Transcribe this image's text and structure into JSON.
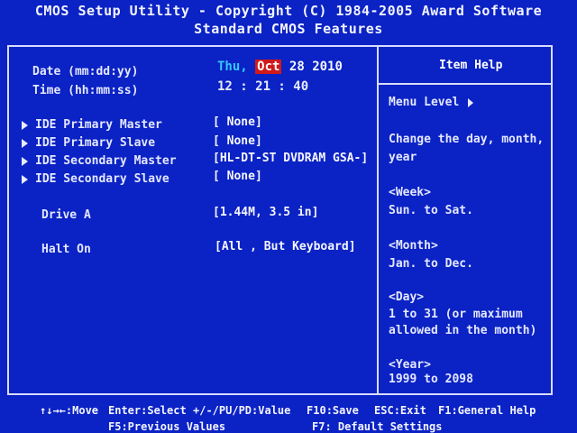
{
  "header": {
    "title": "CMOS Setup Utility - Copyright (C) 1984-2005 Award Software",
    "subtitle": "Standard CMOS Features"
  },
  "main": {
    "date": {
      "label": "Date (mm:dd:yy)",
      "weekday": "Thu,",
      "month": "Oct",
      "day": "28",
      "year": "2010"
    },
    "time": {
      "label": "Time (hh:mm:ss)",
      "value": "12 : 21 : 40"
    },
    "ide_devices": [
      {
        "label": "IDE Primary Master",
        "value": "[ None]"
      },
      {
        "label": "IDE Primary Slave",
        "value": "[ None]"
      },
      {
        "label": "IDE Secondary Master",
        "value": "[HL-DT-ST DVDRAM GSA-]"
      },
      {
        "label": "IDE Secondary Slave",
        "value": "[ None]"
      }
    ],
    "drive_a": {
      "label": "Drive A",
      "value": "[1.44M, 3.5 in]"
    },
    "halt_on": {
      "label": "Halt On",
      "value": "[All , But Keyboard]"
    }
  },
  "help": {
    "title": "Item Help",
    "menu_level": "Menu Level",
    "description": [
      "Change the day, month,",
      "year"
    ],
    "items": [
      {
        "key": "<Week>",
        "desc": [
          "Sun. to Sat."
        ]
      },
      {
        "key": "<Month>",
        "desc": [
          "Jan. to Dec."
        ]
      },
      {
        "key": "<Day>",
        "desc": [
          "1 to 31 (or maximum",
          "allowed in the month)"
        ]
      },
      {
        "key": "<Year>",
        "desc": [
          "1999 to 2098"
        ]
      }
    ]
  },
  "footer": {
    "line1": [
      {
        "key": "↑↓→←",
        "action": ":Move"
      },
      {
        "key": "Enter",
        "action": ":Select"
      },
      {
        "key": "+/-/PU/PD",
        "action": ":Value"
      },
      {
        "key": "F10",
        "action": ":Save"
      },
      {
        "key": "ESC",
        "action": ":Exit"
      },
      {
        "key": "F1",
        "action": ":General Help"
      }
    ],
    "line2": [
      {
        "key": "F5",
        "action": ":Previous Values"
      },
      {
        "key": "F7",
        "action": ": Default Settings"
      }
    ]
  }
}
